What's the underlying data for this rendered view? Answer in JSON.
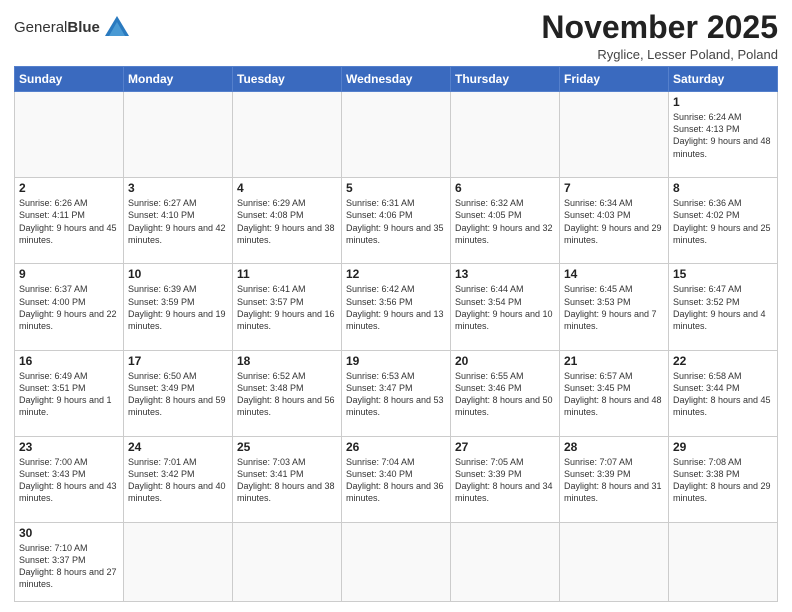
{
  "logo": {
    "text_general": "General",
    "text_blue": "Blue"
  },
  "title": "November 2025",
  "subtitle": "Ryglice, Lesser Poland, Poland",
  "days_of_week": [
    "Sunday",
    "Monday",
    "Tuesday",
    "Wednesday",
    "Thursday",
    "Friday",
    "Saturday"
  ],
  "weeks": [
    [
      {
        "day": "",
        "info": ""
      },
      {
        "day": "",
        "info": ""
      },
      {
        "day": "",
        "info": ""
      },
      {
        "day": "",
        "info": ""
      },
      {
        "day": "",
        "info": ""
      },
      {
        "day": "",
        "info": ""
      },
      {
        "day": "1",
        "info": "Sunrise: 6:24 AM\nSunset: 4:13 PM\nDaylight: 9 hours and 48 minutes."
      }
    ],
    [
      {
        "day": "2",
        "info": "Sunrise: 6:26 AM\nSunset: 4:11 PM\nDaylight: 9 hours and 45 minutes."
      },
      {
        "day": "3",
        "info": "Sunrise: 6:27 AM\nSunset: 4:10 PM\nDaylight: 9 hours and 42 minutes."
      },
      {
        "day": "4",
        "info": "Sunrise: 6:29 AM\nSunset: 4:08 PM\nDaylight: 9 hours and 38 minutes."
      },
      {
        "day": "5",
        "info": "Sunrise: 6:31 AM\nSunset: 4:06 PM\nDaylight: 9 hours and 35 minutes."
      },
      {
        "day": "6",
        "info": "Sunrise: 6:32 AM\nSunset: 4:05 PM\nDaylight: 9 hours and 32 minutes."
      },
      {
        "day": "7",
        "info": "Sunrise: 6:34 AM\nSunset: 4:03 PM\nDaylight: 9 hours and 29 minutes."
      },
      {
        "day": "8",
        "info": "Sunrise: 6:36 AM\nSunset: 4:02 PM\nDaylight: 9 hours and 25 minutes."
      }
    ],
    [
      {
        "day": "9",
        "info": "Sunrise: 6:37 AM\nSunset: 4:00 PM\nDaylight: 9 hours and 22 minutes."
      },
      {
        "day": "10",
        "info": "Sunrise: 6:39 AM\nSunset: 3:59 PM\nDaylight: 9 hours and 19 minutes."
      },
      {
        "day": "11",
        "info": "Sunrise: 6:41 AM\nSunset: 3:57 PM\nDaylight: 9 hours and 16 minutes."
      },
      {
        "day": "12",
        "info": "Sunrise: 6:42 AM\nSunset: 3:56 PM\nDaylight: 9 hours and 13 minutes."
      },
      {
        "day": "13",
        "info": "Sunrise: 6:44 AM\nSunset: 3:54 PM\nDaylight: 9 hours and 10 minutes."
      },
      {
        "day": "14",
        "info": "Sunrise: 6:45 AM\nSunset: 3:53 PM\nDaylight: 9 hours and 7 minutes."
      },
      {
        "day": "15",
        "info": "Sunrise: 6:47 AM\nSunset: 3:52 PM\nDaylight: 9 hours and 4 minutes."
      }
    ],
    [
      {
        "day": "16",
        "info": "Sunrise: 6:49 AM\nSunset: 3:51 PM\nDaylight: 9 hours and 1 minute."
      },
      {
        "day": "17",
        "info": "Sunrise: 6:50 AM\nSunset: 3:49 PM\nDaylight: 8 hours and 59 minutes."
      },
      {
        "day": "18",
        "info": "Sunrise: 6:52 AM\nSunset: 3:48 PM\nDaylight: 8 hours and 56 minutes."
      },
      {
        "day": "19",
        "info": "Sunrise: 6:53 AM\nSunset: 3:47 PM\nDaylight: 8 hours and 53 minutes."
      },
      {
        "day": "20",
        "info": "Sunrise: 6:55 AM\nSunset: 3:46 PM\nDaylight: 8 hours and 50 minutes."
      },
      {
        "day": "21",
        "info": "Sunrise: 6:57 AM\nSunset: 3:45 PM\nDaylight: 8 hours and 48 minutes."
      },
      {
        "day": "22",
        "info": "Sunrise: 6:58 AM\nSunset: 3:44 PM\nDaylight: 8 hours and 45 minutes."
      }
    ],
    [
      {
        "day": "23",
        "info": "Sunrise: 7:00 AM\nSunset: 3:43 PM\nDaylight: 8 hours and 43 minutes."
      },
      {
        "day": "24",
        "info": "Sunrise: 7:01 AM\nSunset: 3:42 PM\nDaylight: 8 hours and 40 minutes."
      },
      {
        "day": "25",
        "info": "Sunrise: 7:03 AM\nSunset: 3:41 PM\nDaylight: 8 hours and 38 minutes."
      },
      {
        "day": "26",
        "info": "Sunrise: 7:04 AM\nSunset: 3:40 PM\nDaylight: 8 hours and 36 minutes."
      },
      {
        "day": "27",
        "info": "Sunrise: 7:05 AM\nSunset: 3:39 PM\nDaylight: 8 hours and 34 minutes."
      },
      {
        "day": "28",
        "info": "Sunrise: 7:07 AM\nSunset: 3:39 PM\nDaylight: 8 hours and 31 minutes."
      },
      {
        "day": "29",
        "info": "Sunrise: 7:08 AM\nSunset: 3:38 PM\nDaylight: 8 hours and 29 minutes."
      }
    ],
    [
      {
        "day": "30",
        "info": "Sunrise: 7:10 AM\nSunset: 3:37 PM\nDaylight: 8 hours and 27 minutes."
      },
      {
        "day": "",
        "info": ""
      },
      {
        "day": "",
        "info": ""
      },
      {
        "day": "",
        "info": ""
      },
      {
        "day": "",
        "info": ""
      },
      {
        "day": "",
        "info": ""
      },
      {
        "day": "",
        "info": ""
      }
    ]
  ]
}
